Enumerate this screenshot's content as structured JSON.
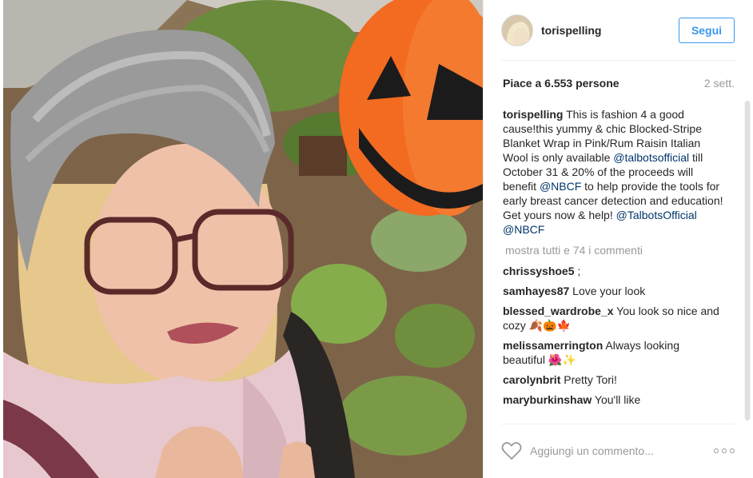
{
  "post": {
    "username": "torispelling",
    "follow_label": "Segui",
    "likes": "Piace a 6.553 persone",
    "time": "2 sett.",
    "caption": {
      "user": "torispelling",
      "text1": " This is fashion 4 a good cause!this yummy & chic Blocked-Stripe Blanket Wrap in Pink/Rum Raisin Italian Wool is only available ",
      "mention1": "@talbotsofficial",
      "text2": " till October 31 & 20% of the proceeds will benefit ",
      "mention2": "@NBCF",
      "text3": " to help provide the tools for early breast cancer detection and education! Get yours now & help! ",
      "mention3": "@TalbotsOfficial",
      "text4": " ",
      "mention4": "@NBCF"
    },
    "view_all": "mostra tutti e 74 i commenti",
    "comments": [
      {
        "user": "chrissyshoe5",
        "text": " ;"
      },
      {
        "user": "samhayes87",
        "text": " Love your look"
      },
      {
        "user": "blessed_wardrobe_x",
        "text": " You look so nice and cozy 🍂🎃🍁"
      },
      {
        "user": "melissamerrington",
        "text": " Always looking beautiful 🌺✨"
      },
      {
        "user": "carolynbrit",
        "text": " Pretty Tori!"
      },
      {
        "user": "maryburkinshaw",
        "text": " You'll like"
      }
    ],
    "comment_placeholder": "Aggiungi un commento..."
  },
  "icons": {
    "heart": "heart-outline-icon",
    "more": "more-options-icon"
  },
  "colors": {
    "accent": "#3897f0",
    "mention": "#003569",
    "muted": "#999999"
  }
}
